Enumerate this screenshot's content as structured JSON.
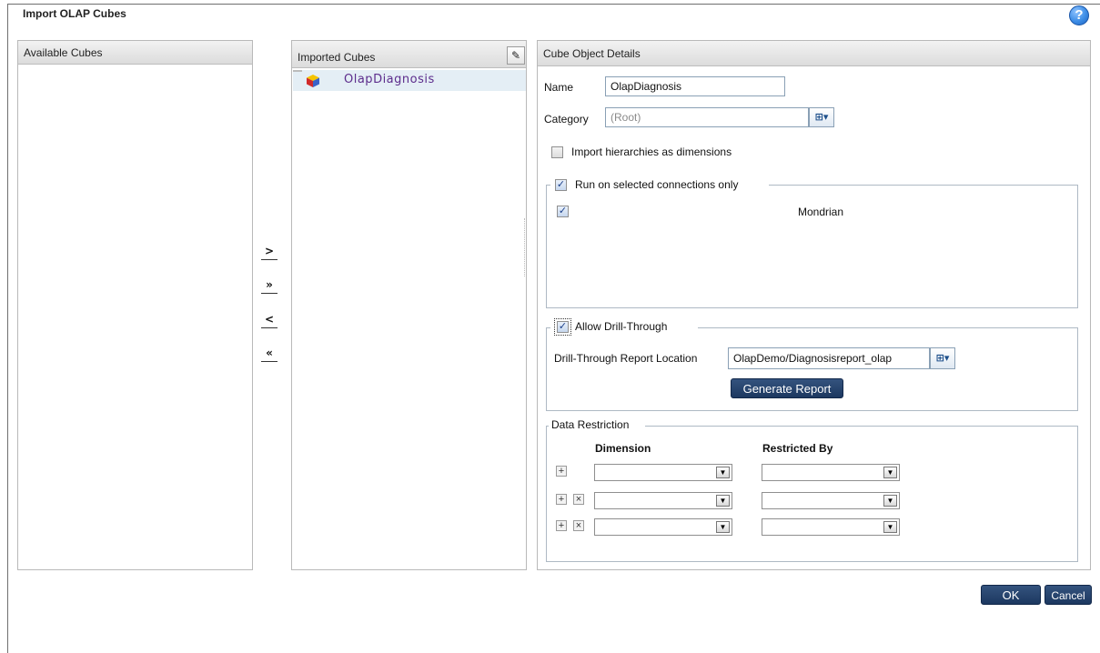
{
  "dialog": {
    "title": "Import OLAP Cubes",
    "help_icon": "question-icon",
    "help_glyph": "?"
  },
  "available_panel": {
    "header": "Available Cubes"
  },
  "imported_panel": {
    "header": "Imported Cubes",
    "edit_icon": "pencil-icon",
    "edit_glyph": "✎",
    "items": [
      {
        "label": "OlapDiagnosis",
        "icon": "cube-icon"
      }
    ]
  },
  "move_buttons": {
    "add_one": ">",
    "add_all": "»",
    "remove_one": "<",
    "remove_all": "«"
  },
  "details_panel": {
    "header": "Cube Object Details",
    "name_label": "Name",
    "name_value": "OlapDiagnosis",
    "category_label": "Category",
    "category_value": "(Root)",
    "tree_glyph": "⊞▾",
    "import_hierarchies_label": "Import hierarchies as dimensions",
    "import_hierarchies_checked": false,
    "run_selected_label": "Run on selected connections only",
    "run_selected_checked": true,
    "connections": [
      {
        "name": "Mondrian",
        "checked": true
      }
    ],
    "drill_through": {
      "label": "Allow Drill-Through",
      "checked": true,
      "location_label": "Drill-Through Report Location",
      "location_value": "OlapDemo/Diagnosisreport_olap",
      "generate_button": "Generate Report"
    },
    "data_restriction": {
      "label": "Data Restriction",
      "dimension_header": "Dimension",
      "restricted_by_header": "Restricted By",
      "add_glyph": "+",
      "remove_glyph": "×",
      "arrow_glyph": "▼",
      "rows": [
        {
          "dimension": "",
          "restricted_by": "",
          "removable": false
        },
        {
          "dimension": "",
          "restricted_by": "",
          "removable": true
        },
        {
          "dimension": "",
          "restricted_by": "",
          "removable": true
        }
      ]
    }
  },
  "footer": {
    "ok": "OK",
    "cancel": "Cancel"
  },
  "colors": {
    "primary_button": "#1c3860",
    "selected_row": "#e4eef5",
    "panel_header": "#dcdcdc"
  }
}
